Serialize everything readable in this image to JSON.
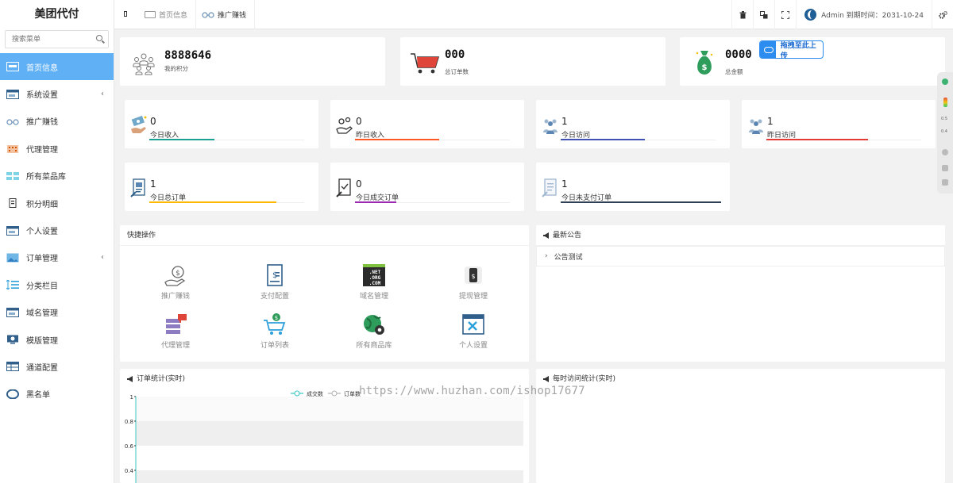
{
  "app": {
    "title": "美团代付"
  },
  "sidebar": {
    "search_placeholder": "搜索菜单",
    "items": [
      {
        "label": "首页信息",
        "icon": "dashboard-icon",
        "active": true,
        "has_arrow": false
      },
      {
        "label": "系统设置",
        "icon": "window-icon",
        "active": false,
        "has_arrow": true
      },
      {
        "label": "推广赚钱",
        "icon": "glasses-icon",
        "active": false,
        "has_arrow": false
      },
      {
        "label": "代理管理",
        "icon": "building-icon",
        "active": false,
        "has_arrow": false
      },
      {
        "label": "所有菜品库",
        "icon": "grid-icon",
        "active": false,
        "has_arrow": false
      },
      {
        "label": "积分明细",
        "icon": "list-icon",
        "active": false,
        "has_arrow": false
      },
      {
        "label": "个人设置",
        "icon": "window-icon",
        "active": false,
        "has_arrow": false
      },
      {
        "label": "订单管理",
        "icon": "picture-icon",
        "active": false,
        "has_arrow": true
      },
      {
        "label": "分类栏目",
        "icon": "sort-icon",
        "active": false,
        "has_arrow": false
      },
      {
        "label": "域名管理",
        "icon": "window-icon",
        "active": false,
        "has_arrow": false
      },
      {
        "label": "模版管理",
        "icon": "monitor-icon",
        "active": false,
        "has_arrow": false
      },
      {
        "label": "通道配置",
        "icon": "table-icon",
        "active": false,
        "has_arrow": false
      },
      {
        "label": "黑名单",
        "icon": "ring-icon",
        "active": false,
        "has_arrow": false
      }
    ]
  },
  "topbar": {
    "tabs": [
      {
        "label": "首页信息"
      },
      {
        "label": "推广赚钱"
      }
    ],
    "admin_text": "Admin 到期时间：2031-10-24"
  },
  "stats_big": [
    {
      "value": "8888646",
      "label": "我的积分",
      "icon": "people-group-icon"
    },
    {
      "value": "000",
      "label": "总订单数",
      "icon": "shopping-cart-icon"
    },
    {
      "value": "0000",
      "label": "总金额",
      "icon": "money-bag-icon"
    }
  ],
  "upload_button": {
    "label": "拖拽至此上传"
  },
  "stats_small": [
    {
      "value": "0",
      "label": "今日收入",
      "color": "#1aa094",
      "icon": "money-hand-icon"
    },
    {
      "value": "0",
      "label": "昨日收入",
      "color": "#ff5722",
      "icon": "coins-icon"
    },
    {
      "value": "1",
      "label": "今日访问",
      "color": "#3f51b5",
      "icon": "visitors-icon"
    },
    {
      "value": "1",
      "label": "昨日访问",
      "color": "#e53935",
      "icon": "visitors-icon"
    },
    {
      "value": "1",
      "label": "今日总订单",
      "color": "#ffb800",
      "icon": "order-doc-icon"
    },
    {
      "value": "0",
      "label": "今日成交订单",
      "color": "#9c27b0",
      "icon": "order-check-icon"
    },
    {
      "value": "1",
      "label": "今日未支付订单",
      "color": "#2f4056",
      "icon": "order-pending-icon"
    }
  ],
  "quick": {
    "title": "快捷操作",
    "items": [
      {
        "label": "推广赚钱",
        "icon": "money-hand-icon"
      },
      {
        "label": "支付配置",
        "icon": "receipt-icon"
      },
      {
        "label": "域名管理",
        "icon": "domain-icon"
      },
      {
        "label": "提现管理",
        "icon": "phone-dollar-icon"
      },
      {
        "label": "代理管理",
        "icon": "server-icon"
      },
      {
        "label": "订单列表",
        "icon": "shopping-cart-icon"
      },
      {
        "label": "所有商品库",
        "icon": "globe-gear-icon"
      },
      {
        "label": "个人设置",
        "icon": "settings-window-icon"
      }
    ]
  },
  "notice": {
    "title": "最新公告",
    "items": [
      {
        "label": "公告测试"
      }
    ]
  },
  "order_chart": {
    "title": "订单统计(实时)",
    "chart_data": {
      "type": "line",
      "series": [
        {
          "name": "成交数",
          "color": "#37c6c0"
        },
        {
          "name": "订单数",
          "color": "#b0b0b0"
        }
      ],
      "y_ticks": [
        "1",
        "0.8",
        "0.6",
        "0.4"
      ],
      "ylim": [
        0,
        1
      ]
    }
  },
  "visit_chart": {
    "title": "每时访问统计(实时)"
  },
  "watermark": "https://www.huzhan.com/ishop17677",
  "float_bar": {
    "labels": [
      "0.5",
      "0.4"
    ]
  }
}
